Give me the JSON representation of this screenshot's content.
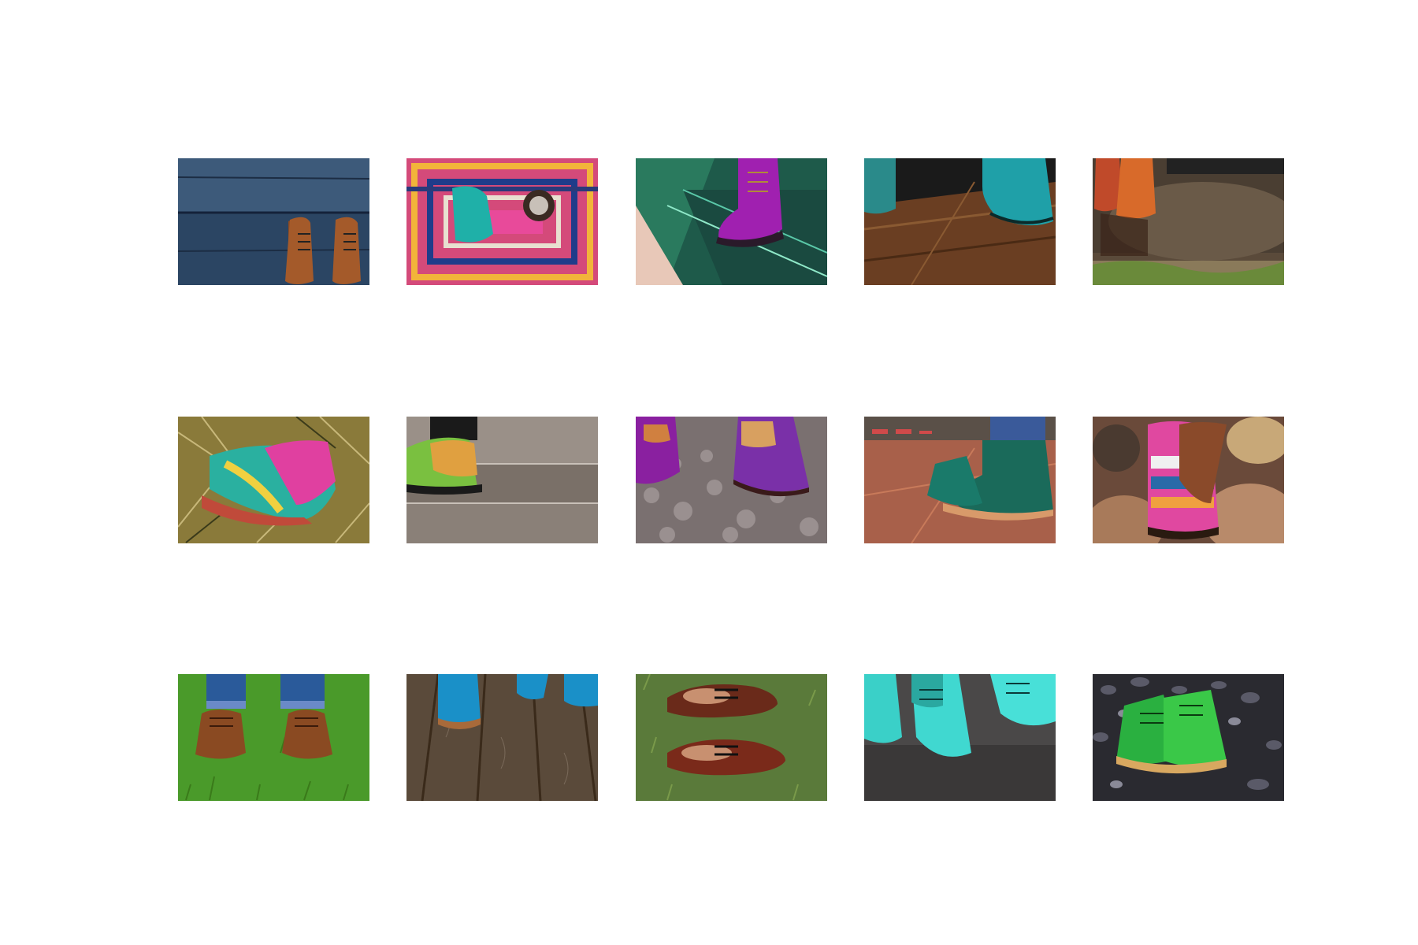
{
  "gallery": {
    "rows": 3,
    "columns": 5,
    "tiles": [
      {
        "subject": "brown-leather-boots-on-blue-wood-planks"
      },
      {
        "subject": "teal-boot-on-patterned-rug"
      },
      {
        "subject": "purple-boot-on-glass-floor"
      },
      {
        "subject": "teal-shoes-on-wood-floor"
      },
      {
        "subject": "orange-boots-in-puddle"
      },
      {
        "subject": "rainbow-boot-on-dry-grass"
      },
      {
        "subject": "iridescent-boot-on-tile-steps"
      },
      {
        "subject": "purple-boots-on-cobblestones"
      },
      {
        "subject": "green-boots-on-terracotta-floor"
      },
      {
        "subject": "patchwork-boot-on-rocks"
      },
      {
        "subject": "brown-boots-on-green-lawn"
      },
      {
        "subject": "blue-shoes-on-wood-deck"
      },
      {
        "subject": "brown-brogues-on-grass"
      },
      {
        "subject": "turquoise-boots-on-asphalt"
      },
      {
        "subject": "green-boots-on-pebbles"
      }
    ]
  }
}
